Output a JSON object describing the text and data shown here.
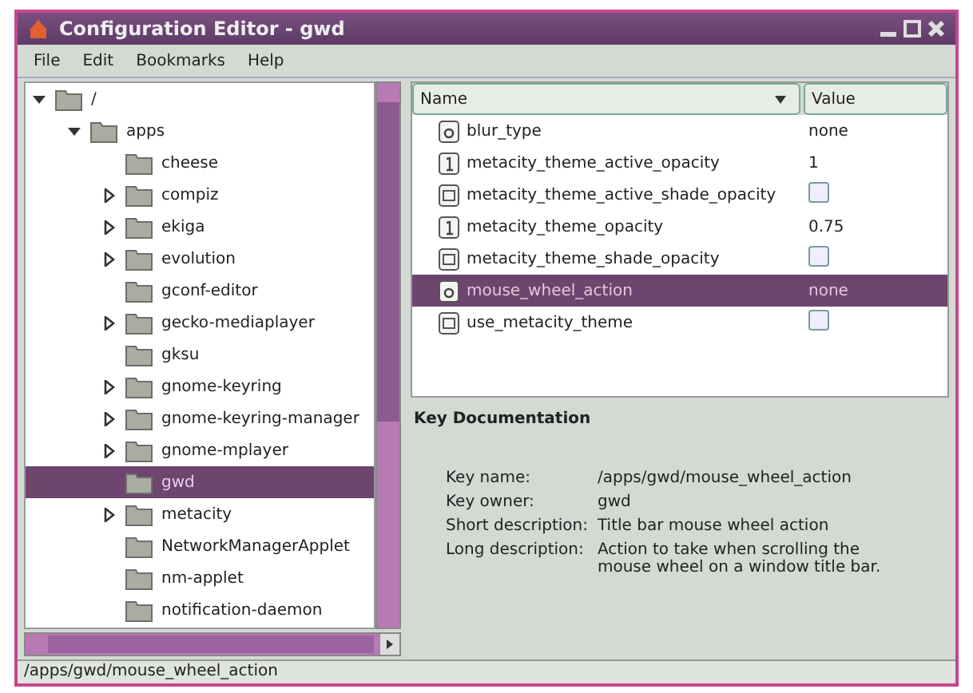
{
  "window": {
    "title": "Configuration Editor - gwd"
  },
  "menu": [
    "File",
    "Edit",
    "Bookmarks",
    "Help"
  ],
  "tree": [
    {
      "name": "/",
      "expanded": true,
      "selected": false,
      "children": [
        {
          "name": "apps",
          "expanded": true,
          "selected": false,
          "children": [
            {
              "name": "cheese",
              "selected": false
            },
            {
              "name": "compiz",
              "expanded": false,
              "selected": false
            },
            {
              "name": "ekiga",
              "expanded": false,
              "selected": false
            },
            {
              "name": "evolution",
              "expanded": false,
              "selected": false
            },
            {
              "name": "gconf-editor",
              "selected": false
            },
            {
              "name": "gecko-mediaplayer",
              "expanded": false,
              "selected": false
            },
            {
              "name": "gksu",
              "selected": false
            },
            {
              "name": "gnome-keyring",
              "expanded": false,
              "selected": false
            },
            {
              "name": "gnome-keyring-manager",
              "expanded": false,
              "selected": false
            },
            {
              "name": "gnome-mplayer",
              "expanded": false,
              "selected": false
            },
            {
              "name": "gwd",
              "selected": true
            },
            {
              "name": "metacity",
              "expanded": false,
              "selected": false
            },
            {
              "name": "NetworkManagerApplet",
              "selected": false
            },
            {
              "name": "nm-applet",
              "selected": false
            },
            {
              "name": "notification-daemon",
              "selected": false
            }
          ]
        }
      ]
    }
  ],
  "keys": {
    "columns": [
      "Name",
      "Value"
    ],
    "rows": [
      {
        "kind": "string",
        "name": "blur_type",
        "value": "none",
        "selected": false
      },
      {
        "kind": "int",
        "name": "metacity_theme_active_opacity",
        "value": "1",
        "selected": false
      },
      {
        "kind": "bool",
        "name": "metacity_theme_active_shade_opacity",
        "checked": false,
        "selected": false
      },
      {
        "kind": "int",
        "name": "metacity_theme_opacity",
        "value": "0.75",
        "selected": false
      },
      {
        "kind": "bool",
        "name": "metacity_theme_shade_opacity",
        "checked": false,
        "selected": false
      },
      {
        "kind": "string",
        "name": "mouse_wheel_action",
        "value": "none",
        "selected": true
      },
      {
        "kind": "bool",
        "name": "use_metacity_theme",
        "checked": false,
        "selected": false
      }
    ]
  },
  "documentation": {
    "title": "Key Documentation",
    "fields": [
      {
        "label": "Key name:",
        "value": "/apps/gwd/mouse_wheel_action"
      },
      {
        "label": "Key owner:",
        "value": "gwd"
      },
      {
        "label": "Short description:",
        "value": "Title bar mouse wheel action"
      },
      {
        "label": "Long description:",
        "value": "Action to take when scrolling the mouse wheel on a window title bar."
      }
    ]
  },
  "status_bar": "/apps/gwd/mouse_wheel_action"
}
